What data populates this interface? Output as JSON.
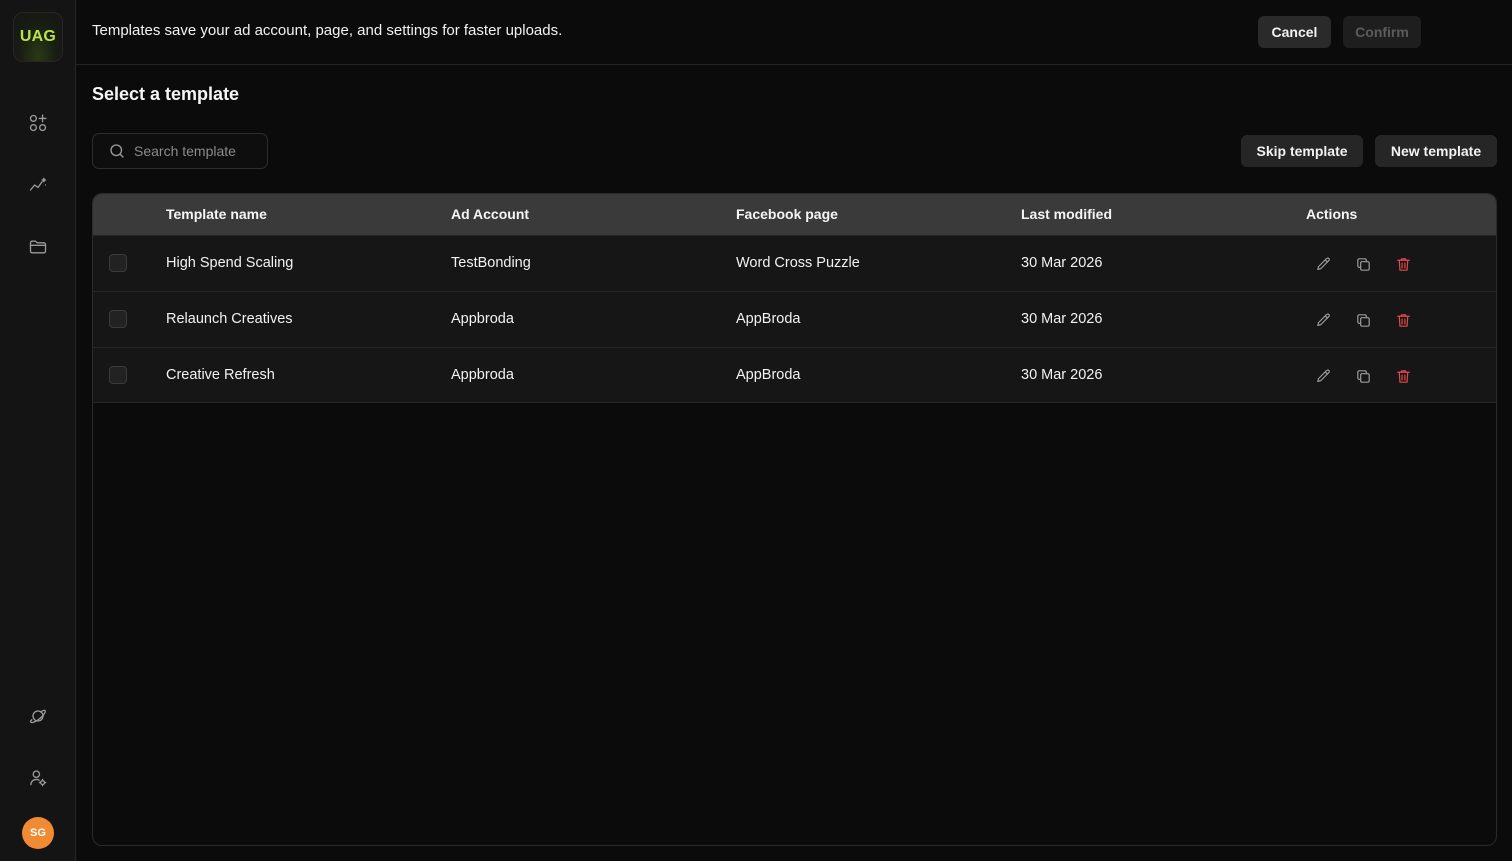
{
  "brand": {
    "logo_text": "UAG"
  },
  "sidebar": {
    "nav": [
      {
        "icon": "apps-sparkle-icon"
      },
      {
        "icon": "analytics-icon"
      },
      {
        "icon": "folder-icon"
      }
    ],
    "bottom": [
      {
        "icon": "planet-icon"
      },
      {
        "icon": "user-settings-icon"
      }
    ],
    "avatar_initials": "SG"
  },
  "topbar": {
    "message": "Templates save your ad account, page, and settings for faster uploads.",
    "cancel_label": "Cancel",
    "confirm_label": "Confirm"
  },
  "main": {
    "title": "Select a template",
    "search_placeholder": "Search template",
    "skip_label": "Skip template",
    "new_label": "New template"
  },
  "table": {
    "columns": [
      "Template name",
      "Ad Account",
      "Facebook page",
      "Last modified",
      "Actions"
    ],
    "rows": [
      {
        "name": "High Spend Scaling",
        "ad_account": "TestBonding",
        "page": "Word Cross Puzzle",
        "modified": "30 Mar 2026"
      },
      {
        "name": "Relaunch Creatives",
        "ad_account": "Appbroda",
        "page": "AppBroda",
        "modified": "30 Mar 2026"
      },
      {
        "name": "Creative Refresh",
        "ad_account": "Appbroda",
        "page": "AppBroda",
        "modified": "30 Mar 2026"
      }
    ]
  },
  "colors": {
    "accent": "#b9e34a",
    "avatar": "#f08a33",
    "delete": "#e5484d",
    "background": "#0b0b0b"
  }
}
